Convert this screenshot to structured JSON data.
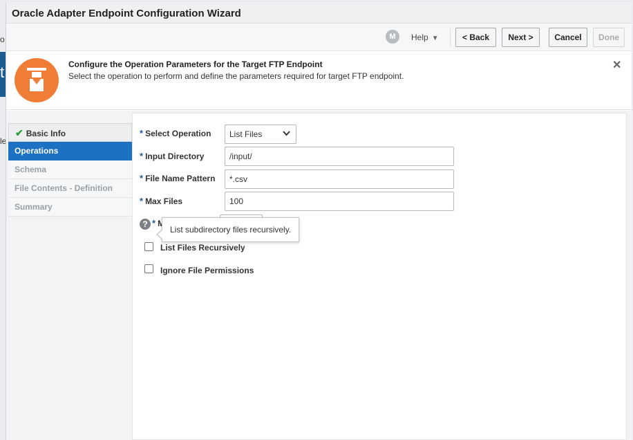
{
  "dialog": {
    "title": "Oracle Adapter Endpoint Configuration Wizard"
  },
  "toolbar": {
    "help_label": "Help",
    "back_label": "< Back",
    "next_label": "Next >",
    "cancel_label": "Cancel",
    "done_label": "Done"
  },
  "header": {
    "title": "Configure the Operation Parameters for the Target FTP Endpoint",
    "subtitle": "Select the operation to perform and define the parameters required for target FTP endpoint.",
    "close": "✕",
    "accent_color": "#ef7d35"
  },
  "background": {
    "frag_1": "t",
    "frag_2": "o",
    "frag_3": "le"
  },
  "nav": {
    "items": [
      {
        "label": "Basic Info",
        "state": "done"
      },
      {
        "label": "Operations",
        "state": "active"
      },
      {
        "label": "Schema",
        "state": "disabled"
      },
      {
        "label": "File Contents - Definition",
        "state": "disabled"
      },
      {
        "label": "Summary",
        "state": "disabled"
      }
    ],
    "active_color": "#1d71c3"
  },
  "form": {
    "select_operation": {
      "label": "Select Operation",
      "value": "List Files"
    },
    "input_directory": {
      "label": "Input Directory",
      "value": "/input/"
    },
    "file_name_pattern": {
      "label": "File Name Pattern",
      "value": "*.csv"
    },
    "max_files": {
      "label": "Max Files",
      "value": "100"
    },
    "hidden_field_label": "M",
    "tooltip": "List subdirectory files recursively.",
    "list_recursively": {
      "label": "List Files Recursively",
      "checked": false
    },
    "ignore_permissions": {
      "label": "Ignore File Permissions",
      "checked": false
    }
  }
}
